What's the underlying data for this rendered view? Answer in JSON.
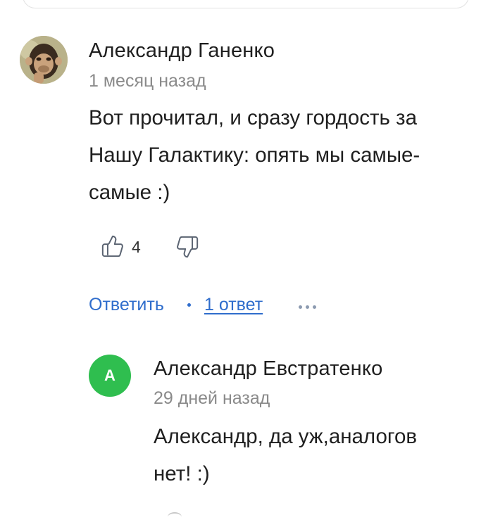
{
  "comment": {
    "author": "Александр Ганенко",
    "time": "1 месяц назад",
    "text_lines": [
      "Вот прочитал, и сразу гордость за",
      "Нашу Галактику: опять мы самые-",
      "самые :)"
    ],
    "likes": "4",
    "reply_label": "Ответить",
    "replies_label": "1 ответ"
  },
  "reply": {
    "avatar_letter": "А",
    "avatar_color": "#2fbe4f",
    "author": "Александр Евстратенко",
    "time": "29 дней назад",
    "text_lines": [
      "Александр, да уж,аналогов",
      "нет! :)"
    ]
  },
  "colors": {
    "link": "#2f6dcc",
    "muted": "#8a8a8a"
  },
  "icons": {
    "like": "thumbs-up-icon",
    "dislike": "thumbs-down-icon",
    "more": "more-horizontal-icon"
  }
}
